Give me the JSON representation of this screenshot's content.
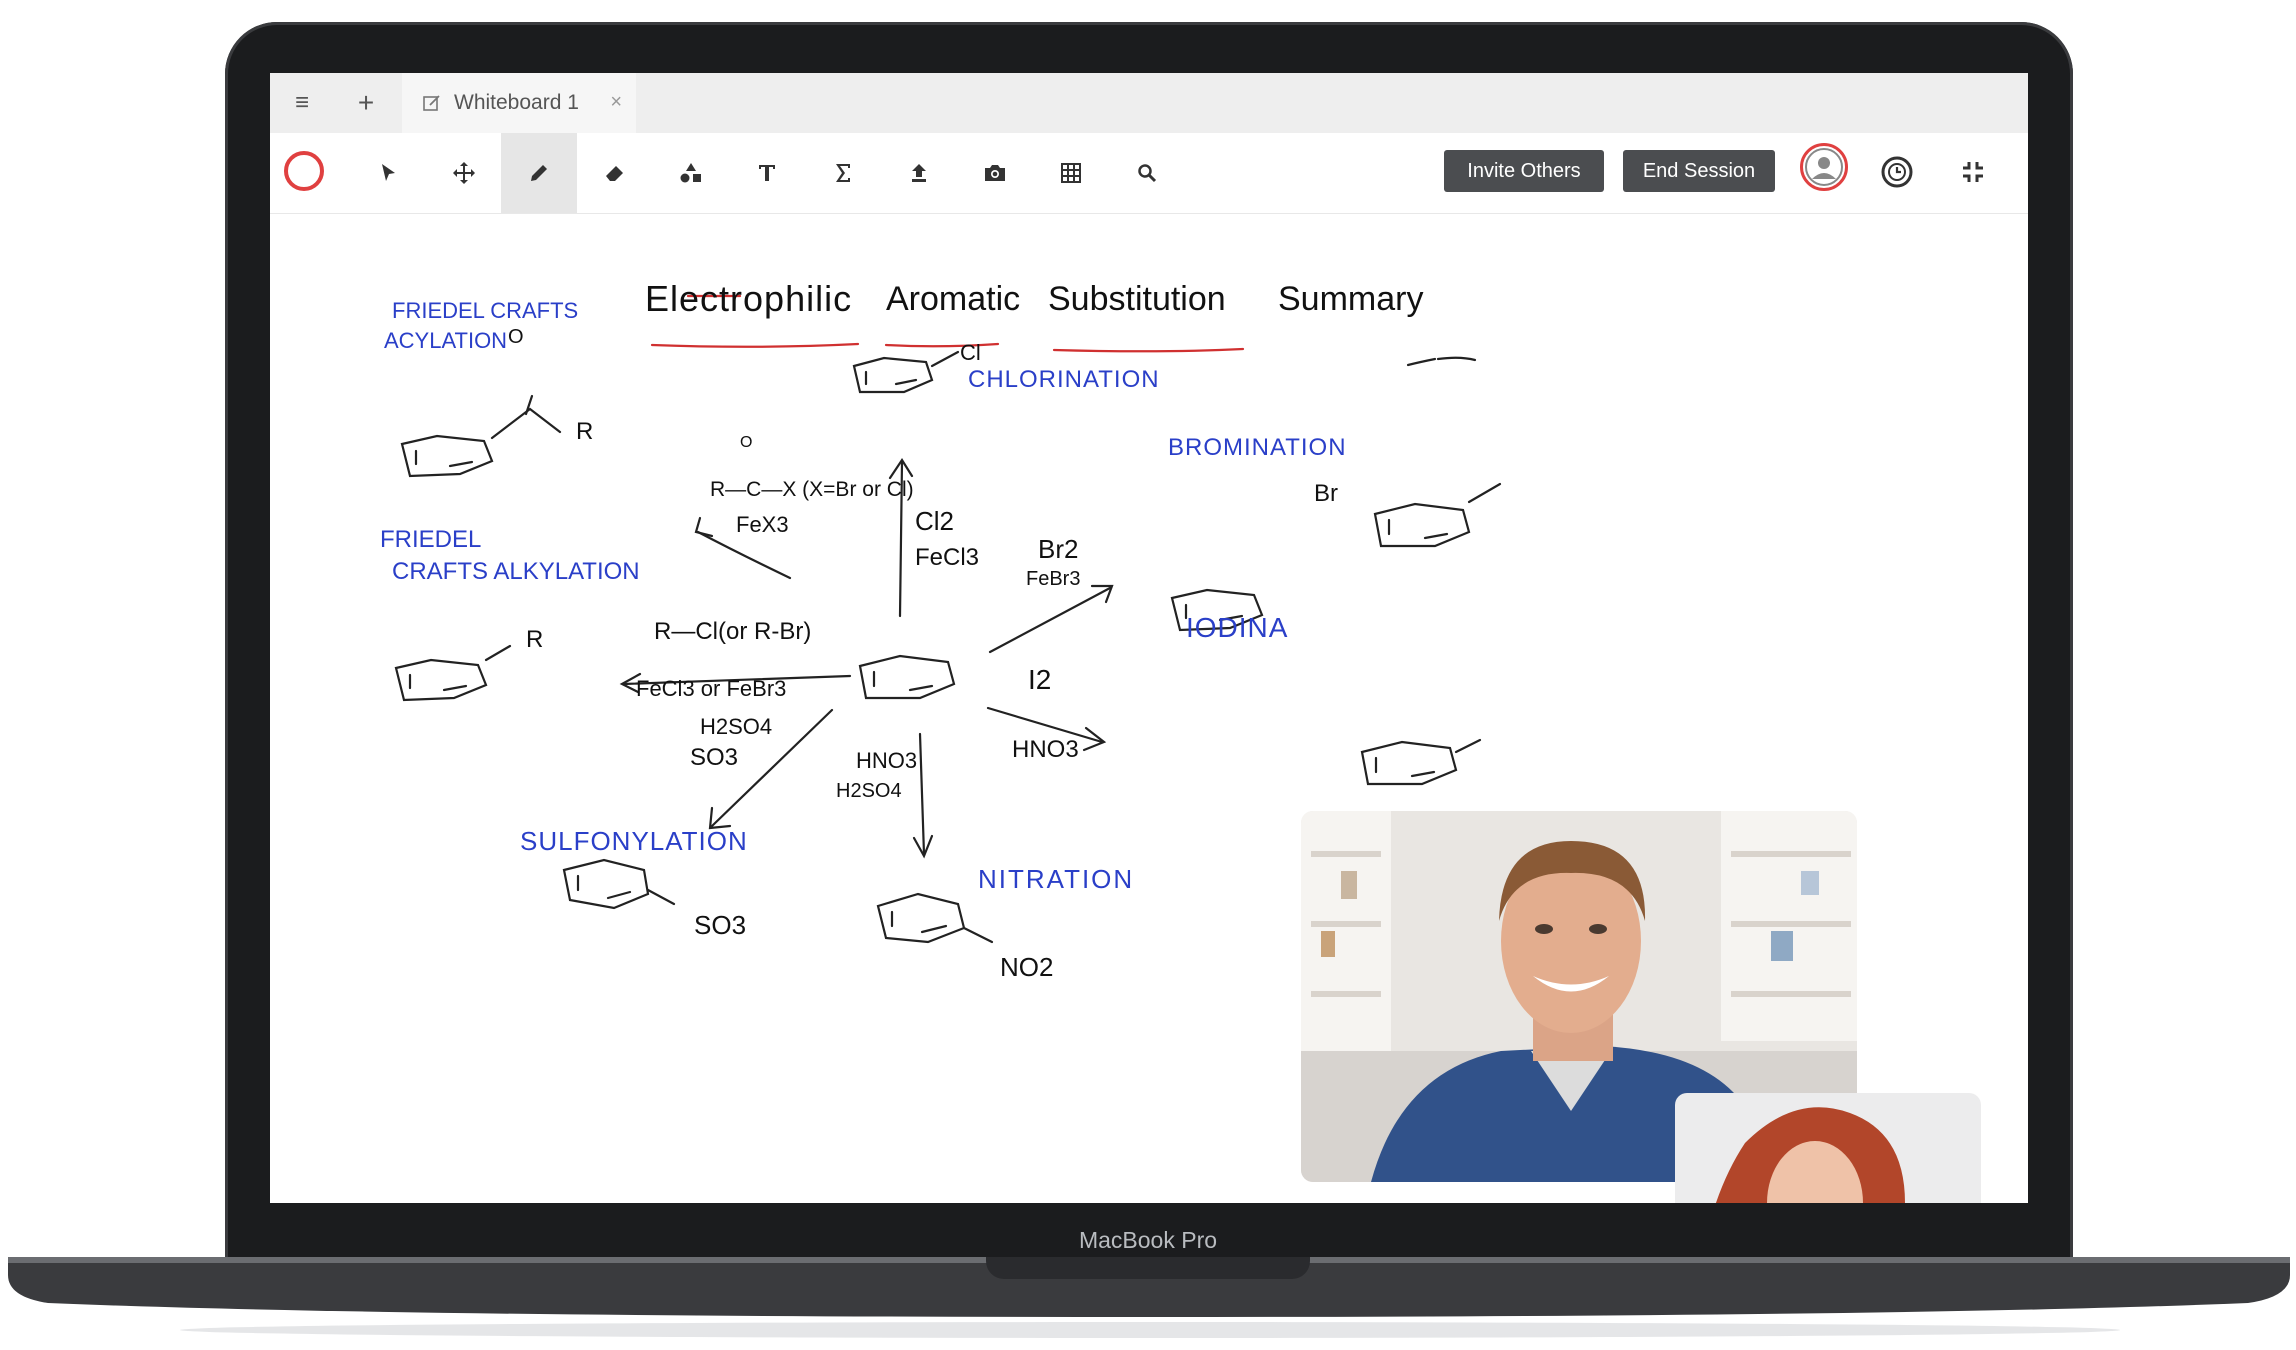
{
  "window": {
    "device_label": "MacBook Pro"
  },
  "tabs": [
    {
      "label": "Whiteboard 1",
      "close": "×"
    }
  ],
  "tabbar": {
    "menu_icon": "≡",
    "add_icon": "+"
  },
  "toolbar": {
    "tools": [
      "record",
      "select",
      "move",
      "pen",
      "eraser",
      "shapes",
      "text",
      "formula",
      "upload",
      "camera",
      "grid",
      "search"
    ],
    "active_tool": "pen",
    "invite_label": "Invite Others",
    "end_label": "End Session"
  },
  "whiteboard": {
    "title_words": [
      "Electrophilic",
      "Aromatic",
      "Substitution",
      "Summary"
    ],
    "labels": {
      "friedel_acyl_1": "FRIEDEL CRAFTS",
      "friedel_acyl_2": "ACYLATION",
      "chlorination": "CHLORINATION",
      "bromination": "BROMINATION",
      "friedel_alk_1": "FRIEDEL",
      "friedel_alk_2": "CRAFTS ALKYLATION",
      "iodination": "IODINA",
      "sulfonylation": "SULFONYLATION",
      "nitration": "NITRATION"
    },
    "reagents": {
      "acyl_top": "O",
      "acyl_mid": "R—C—X (X=Br or Cl)",
      "acyl_cat": "FeX3",
      "cl2": "Cl2",
      "fecl3": "FeCl3",
      "br2": "Br2",
      "febr3": "FeBr3",
      "alkyl": "R—Cl(or R-Br)",
      "alkyl_cat": "FeCl3 or FeBr3",
      "i2": "I2",
      "h2so4": "H2SO4",
      "so3": "SO3",
      "hno3_a": "HNO3",
      "h2so4_b": "H2SO4",
      "hno3_b": "HNO3",
      "sub_cl": "Cl",
      "sub_br": "Br",
      "sub_r1": "R",
      "sub_r2": "R",
      "sub_o": "O",
      "sub_so3": "SO3",
      "sub_no2": "NO2"
    }
  }
}
